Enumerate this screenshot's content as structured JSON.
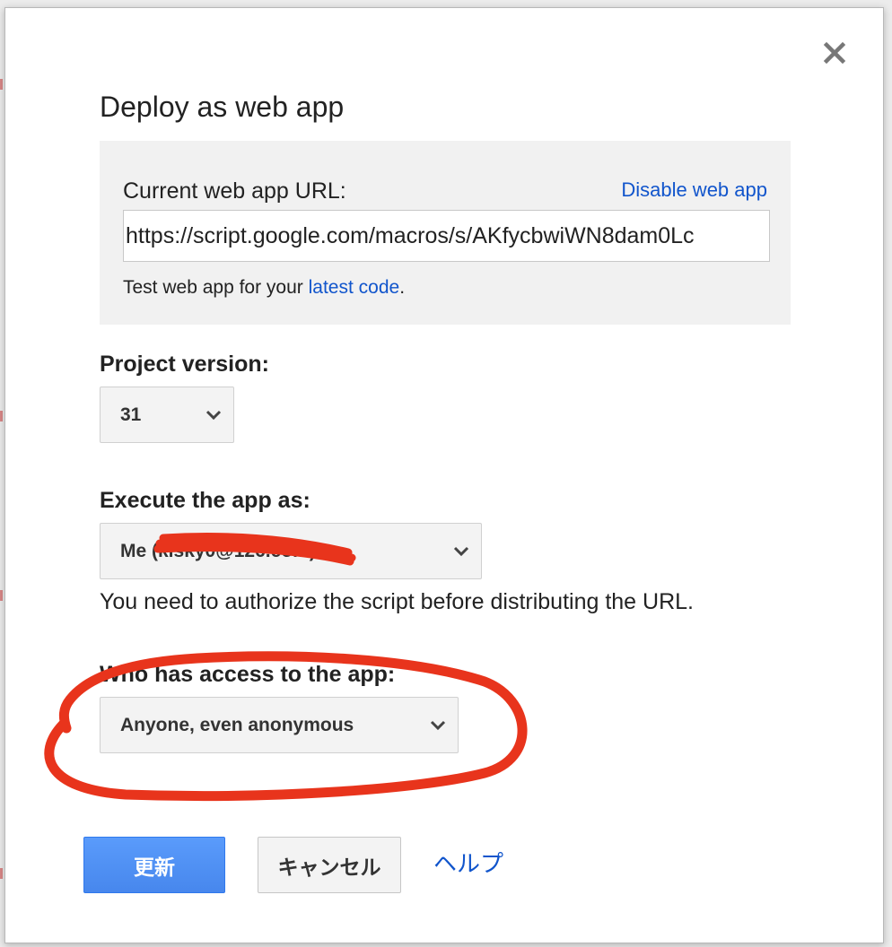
{
  "dialog": {
    "title": "Deploy as web app"
  },
  "url_panel": {
    "label": "Current web app URL:",
    "disable_label": "Disable web app",
    "url_value": "https://script.google.com/macros/s/AKfycbwiWN8dam0Lc",
    "test_prefix": "Test web app for your ",
    "test_link": "latest code",
    "test_suffix": "."
  },
  "project_version": {
    "label": "Project version:",
    "selected": "31"
  },
  "execute_as": {
    "label": "Execute the app as:",
    "selected": "Me (kisky0@126.com)",
    "note": "You need to authorize the script before distributing the URL."
  },
  "access": {
    "label": "Who has access to the app:",
    "selected": "Anyone, even anonymous"
  },
  "buttons": {
    "update": "更新",
    "cancel": "キャンセル",
    "help": "ヘルプ"
  },
  "colors": {
    "link": "#1155cc",
    "primary": "#4d90fe",
    "annotation": "#e8341c"
  },
  "icons": {
    "close": "close-icon",
    "dropdown": "chevron-down-icon"
  }
}
